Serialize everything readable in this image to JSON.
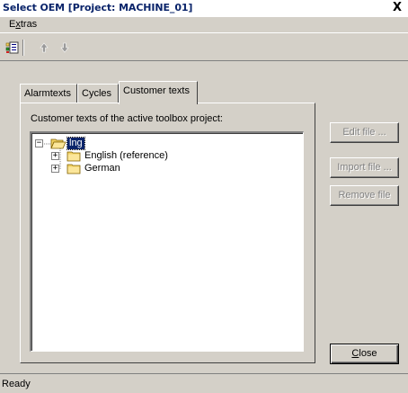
{
  "window": {
    "title": "Select OEM [Project: MACHINE_01]",
    "close_glyph": "X"
  },
  "menu": {
    "items": [
      {
        "label_prefix": "E",
        "label_underlined": "x",
        "label_suffix": "tras"
      }
    ]
  },
  "toolbar": {
    "icons": [
      "list-icon",
      "arrow-up-icon",
      "arrow-down-icon"
    ]
  },
  "tabs": [
    {
      "label": "Alarmtexts",
      "active": false
    },
    {
      "label": "Cycles",
      "active": false
    },
    {
      "label": "Customer texts",
      "active": true
    }
  ],
  "panel": {
    "label": "Customer texts of the active toolbox project:"
  },
  "tree": {
    "root": {
      "label": "lng",
      "expanded": true,
      "selected": true
    },
    "children": [
      {
        "label": "English (reference)",
        "expanded": false
      },
      {
        "label": "German",
        "expanded": false
      }
    ]
  },
  "buttons": {
    "edit_file": "Edit file ...",
    "import_file": "Import file ...",
    "remove_file": "Remove file",
    "close_prefix": "",
    "close_underlined": "C",
    "close_suffix": "lose"
  },
  "status": {
    "text": "Ready"
  },
  "colors": {
    "title_text": "#0a246a",
    "face": "#d4d0c8",
    "selection": "#0a246a",
    "folder": "#f2d264"
  }
}
